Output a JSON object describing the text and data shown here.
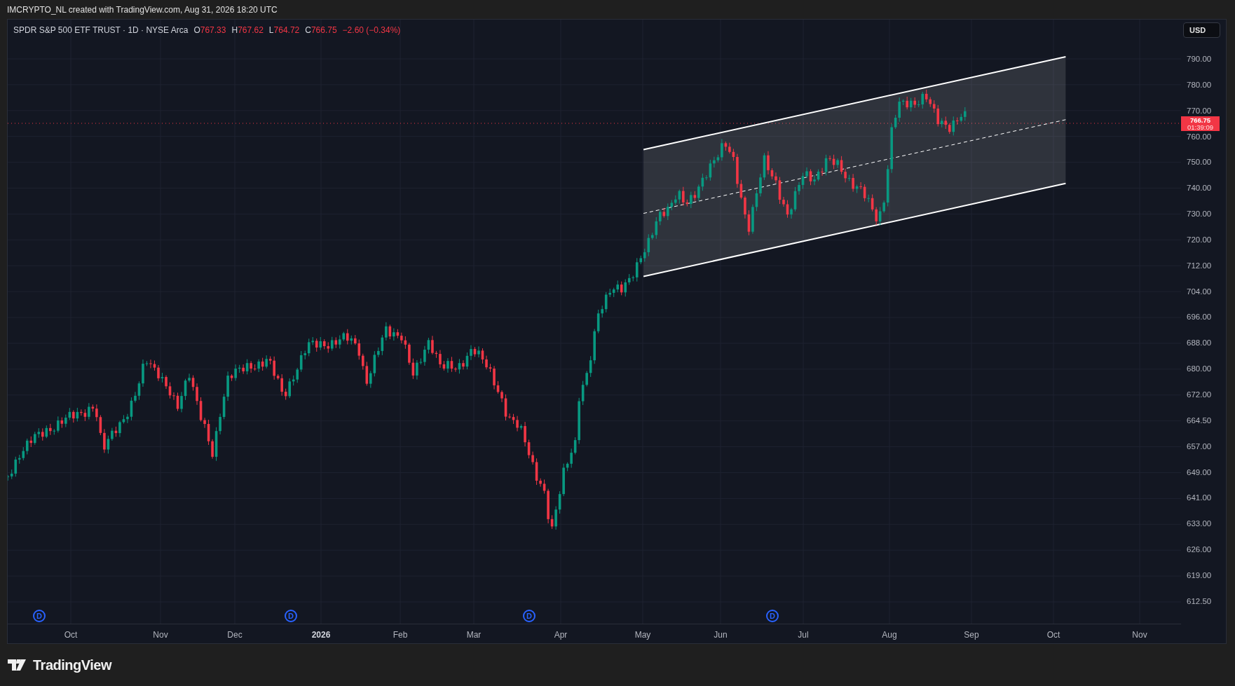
{
  "header": {
    "text": "IMCRYPTO_NL created with TradingView.com, Aug 31, 2026 18:20 UTC"
  },
  "legend": {
    "symbol": "SPDR S&P 500 ETF TRUST · 1D · NYSE Arca",
    "ohlc": [
      {
        "key": "O",
        "value": "767.33"
      },
      {
        "key": "H",
        "value": "767.62"
      },
      {
        "key": "L",
        "value": "764.72"
      },
      {
        "key": "C",
        "value": "766.75"
      }
    ],
    "change": "−2.60 (−0.34%)"
  },
  "currency_button": "USD",
  "price_axis": [
    "790.00",
    "780.00",
    "770.00",
    "760.00",
    "750.00",
    "740.00",
    "730.00",
    "720.00",
    "712.00",
    "704.00",
    "696.00",
    "688.00",
    "680.00",
    "672.00",
    "664.50",
    "657.00",
    "649.00",
    "641.00",
    "633.00",
    "626.00",
    "619.00",
    "612.50"
  ],
  "price_tag": {
    "price": "766.75",
    "countdown": "01:39:09"
  },
  "time_axis": [
    {
      "label": "Oct",
      "bold": false
    },
    {
      "label": "Nov",
      "bold": false
    },
    {
      "label": "Dec",
      "bold": false
    },
    {
      "label": "2026",
      "bold": true
    },
    {
      "label": "Feb",
      "bold": false
    },
    {
      "label": "Mar",
      "bold": false
    },
    {
      "label": "Apr",
      "bold": false
    },
    {
      "label": "May",
      "bold": false
    },
    {
      "label": "Jun",
      "bold": false
    },
    {
      "label": "Jul",
      "bold": false
    },
    {
      "label": "Aug",
      "bold": false
    },
    {
      "label": "Sep",
      "bold": false
    },
    {
      "label": "Oct",
      "bold": false
    },
    {
      "label": "Nov",
      "bold": false
    }
  ],
  "dividend_markers": [
    "D",
    "D",
    "D",
    "D"
  ],
  "logo": "TradingView"
}
